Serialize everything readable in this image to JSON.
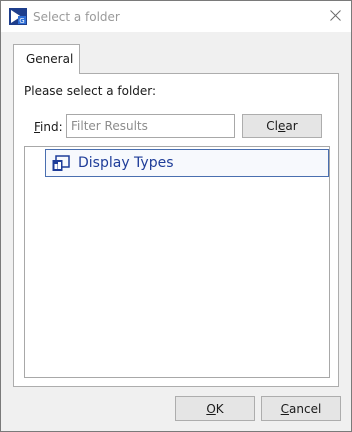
{
  "window": {
    "title": "Select a folder"
  },
  "tabs": [
    {
      "label": "General"
    }
  ],
  "panel": {
    "prompt": "Please select a folder:",
    "find_label_accel": "F",
    "find_label_rest": "ind:",
    "filter_value": "",
    "filter_placeholder": "Filter Results",
    "clear_accel_pre": "Cl",
    "clear_accel": "e",
    "clear_rest": "ar"
  },
  "tree": {
    "items": [
      {
        "label": "Display Types",
        "icon": "display-types-folder-icon",
        "selected": true
      }
    ]
  },
  "footer": {
    "ok_accel": "O",
    "ok_rest": "K",
    "cancel_accel": "C",
    "cancel_rest": "ancel"
  },
  "colors": {
    "title_text": "#9a9a9a",
    "selection_border": "#4a6fb0",
    "tree_text": "#1f3d99",
    "button_face": "#e5e5e5",
    "dialog_background": "#f0f0f0"
  }
}
